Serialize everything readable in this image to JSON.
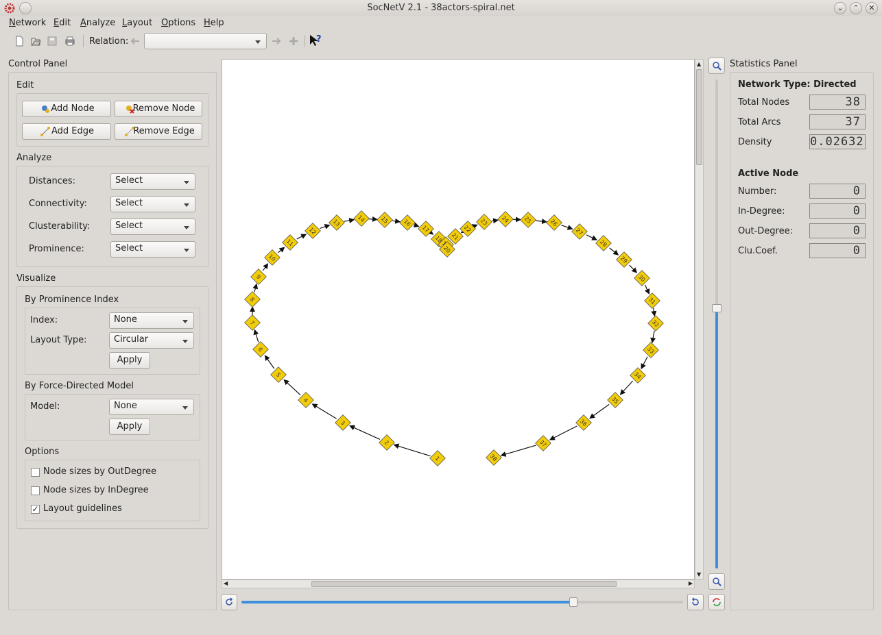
{
  "window": {
    "title": "SocNetV 2.1 - 38actors-spiral.net"
  },
  "menu": [
    "Network",
    "Edit",
    "Analyze",
    "Layout",
    "Options",
    "Help"
  ],
  "toolbar": {
    "relation_label": "Relation:",
    "relation_value": ""
  },
  "control_panel": {
    "title": "Control Panel",
    "edit": {
      "title": "Edit",
      "add_node": "Add Node",
      "remove_node": "Remove Node",
      "add_edge": "Add Edge",
      "remove_edge": "Remove Edge"
    },
    "analyze": {
      "title": "Analyze",
      "rows": [
        {
          "label": "Distances:",
          "value": "Select"
        },
        {
          "label": "Connectivity:",
          "value": "Select"
        },
        {
          "label": "Clusterability:",
          "value": "Select"
        },
        {
          "label": "Prominence:",
          "value": "Select"
        }
      ]
    },
    "visualize": {
      "title": "Visualize",
      "prominence": {
        "title": "By Prominence Index",
        "index_label": "Index:",
        "index_value": "None",
        "layout_label": "Layout Type:",
        "layout_value": "Circular",
        "apply": "Apply"
      },
      "force": {
        "title": "By Force-Directed Model",
        "model_label": "Model:",
        "model_value": "None",
        "apply": "Apply"
      }
    },
    "options": {
      "title": "Options",
      "items": [
        {
          "label": "Node sizes by OutDegree",
          "checked": false
        },
        {
          "label": "Node sizes by InDegree",
          "checked": false
        },
        {
          "label": "Layout guidelines",
          "checked": true
        }
      ]
    }
  },
  "statistics_panel": {
    "title": "Statistics Panel",
    "network_type": "Network Type: Directed",
    "total_nodes_label": "Total Nodes",
    "total_nodes": "38",
    "total_arcs_label": "Total Arcs",
    "total_arcs": "37",
    "density_label": "Density",
    "density": "0.02632",
    "active_node_title": "Active Node",
    "number_label": "Number:",
    "number": "0",
    "indegree_label": "In-Degree:",
    "indegree": "0",
    "outdegree_label": "Out-Degree:",
    "outdegree": "0",
    "clucoef_label": "Clu.Coef.",
    "clucoef": "0"
  },
  "graph": {
    "node_color": "#f2cc0a",
    "node_labels": [
      "1",
      "2",
      "3",
      "4",
      "5",
      "6",
      "7",
      "8",
      "9",
      "10",
      "11",
      "12",
      "13",
      "14",
      "15",
      "16",
      "17",
      "18",
      "19",
      "20",
      "21",
      "22",
      "23",
      "24",
      "25",
      "26",
      "27",
      "28",
      "29",
      "30",
      "31",
      "32",
      "33",
      "34",
      "35",
      "36",
      "37",
      "38"
    ]
  }
}
